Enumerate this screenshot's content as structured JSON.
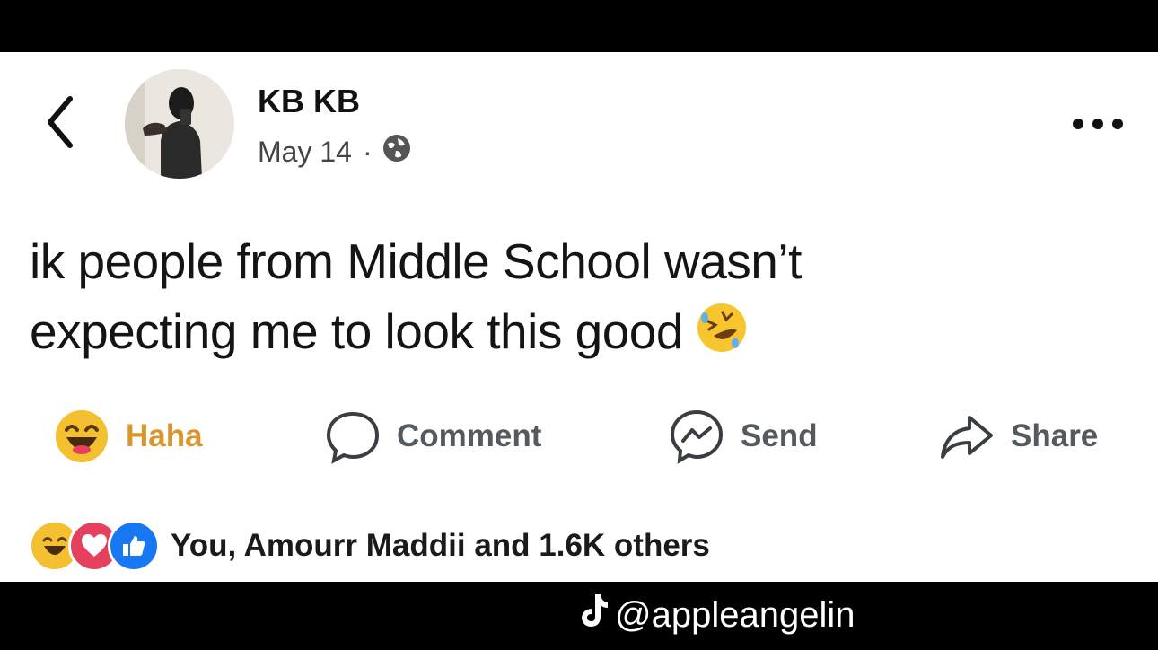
{
  "post": {
    "author": "KB KB",
    "date": "May 14",
    "dot": "·",
    "text_line1": "ik people from Middle School wasn’t",
    "text_line2": "expecting me to look this good"
  },
  "actions": {
    "haha": "Haha",
    "comment": "Comment",
    "send": "Send",
    "share": "Share"
  },
  "reactions": {
    "summary": "You, Amourr Maddii and 1.6K others"
  },
  "watermark": {
    "handle": "@appleangelin"
  },
  "colors": {
    "haha": "#d9962b",
    "love": "#e5405e",
    "like": "#1877f2"
  }
}
